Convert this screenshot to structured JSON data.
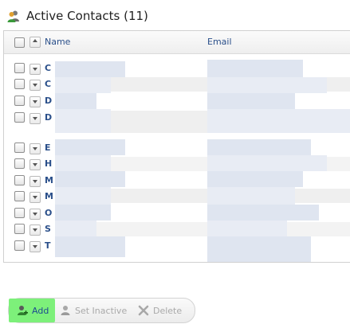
{
  "header": {
    "title": "Active Contacts (11)"
  },
  "table": {
    "columns": {
      "name": "Name",
      "email": "Email"
    },
    "rows": [
      {
        "name_initial": "C"
      },
      {
        "name_initial": "C"
      },
      {
        "name_initial": "D"
      },
      {
        "name_initial": "D"
      },
      {
        "name_initial": "E"
      },
      {
        "name_initial": "H"
      },
      {
        "name_initial": "M"
      },
      {
        "name_initial": "M"
      },
      {
        "name_initial": "O"
      },
      {
        "name_initial": "S"
      },
      {
        "name_initial": "T"
      }
    ]
  },
  "toolbar": {
    "add_label": "Add",
    "set_inactive_label": "Set Inactive",
    "delete_label": "Delete"
  },
  "icons": {
    "header": "contacts-icon",
    "add": "add-user-icon",
    "set_inactive": "user-icon",
    "delete": "delete-x-icon"
  },
  "colors": {
    "add_highlight": "#7df07a",
    "link": "#2a4f8a"
  }
}
